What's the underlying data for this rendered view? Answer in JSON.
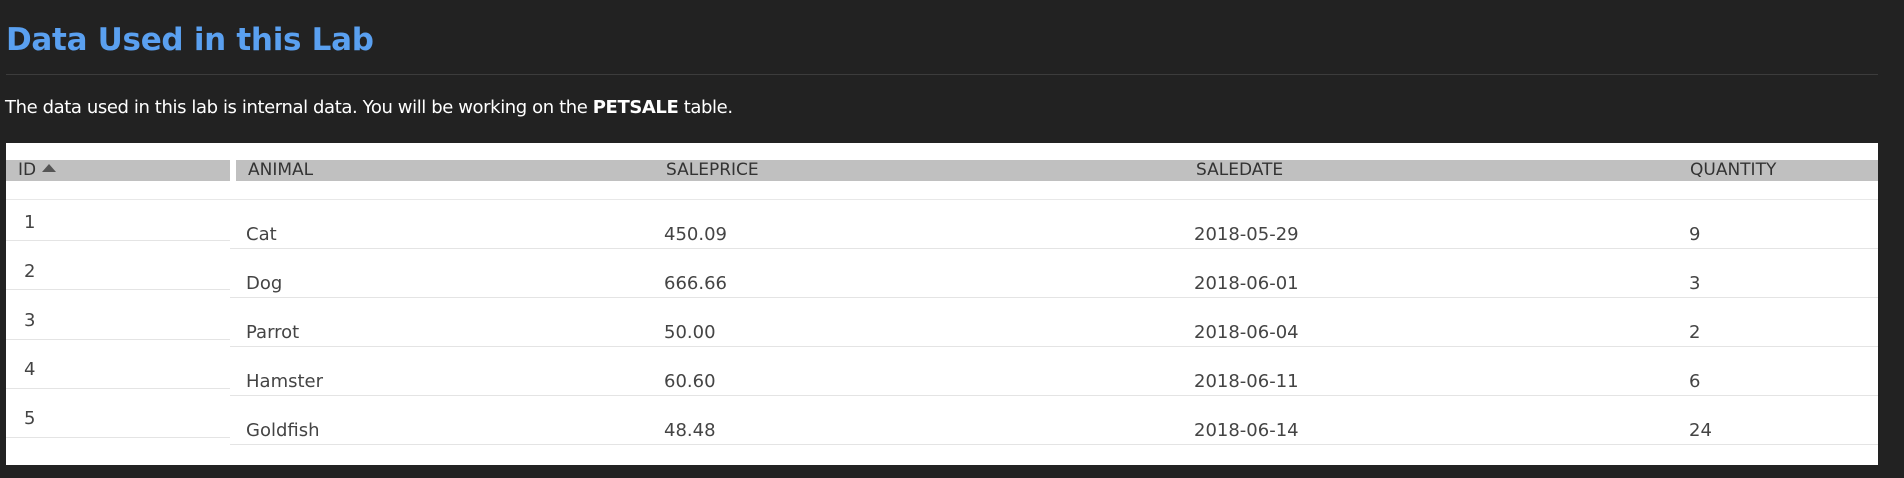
{
  "heading": "Data Used in this Lab",
  "intro": {
    "before": "The data used in this lab is internal data. You will be working on the ",
    "bold": "PETSALE",
    "after": " table."
  },
  "table": {
    "columns": [
      "ID",
      "ANIMAL",
      "SALEPRICE",
      "SALEDATE",
      "QUANTITY"
    ],
    "sort_icon": "sort-ascending-icon",
    "rows": [
      [
        "1",
        "Cat",
        "450.09",
        "2018-05-29",
        "9"
      ],
      [
        "2",
        "Dog",
        "666.66",
        "2018-06-01",
        "3"
      ],
      [
        "3",
        "Parrot",
        "50.00",
        "2018-06-04",
        "2"
      ],
      [
        "4",
        "Hamster",
        "60.60",
        "2018-06-11",
        "6"
      ],
      [
        "5",
        "Goldfish",
        "48.48",
        "2018-06-14",
        "24"
      ]
    ]
  },
  "colors": {
    "page_background": "#222222",
    "heading": "#5aa0f0",
    "header_cell": "#c0c0c0"
  }
}
